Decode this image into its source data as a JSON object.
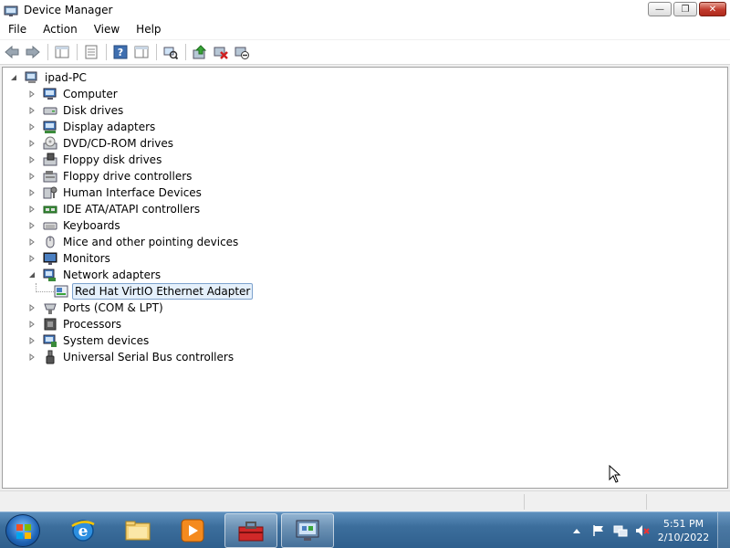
{
  "window": {
    "title": "Device Manager",
    "minimize_glyph": "—",
    "maximize_glyph": "❐",
    "close_glyph": "✕"
  },
  "menu": [
    "File",
    "Action",
    "View",
    "Help"
  ],
  "toolbar": {
    "buttons": [
      "back-icon",
      "forward-icon",
      "show-hide-console-tree-icon",
      "properties-icon",
      "help-icon",
      "action-pane-icon",
      "scan-hardware-icon",
      "update-driver-icon",
      "uninstall-icon",
      "disable-device-icon"
    ]
  },
  "tree": {
    "root": "ipad-PC",
    "categories": [
      {
        "label": "Computer",
        "icon": "computer-icon"
      },
      {
        "label": "Disk drives",
        "icon": "disk-drive-icon"
      },
      {
        "label": "Display adapters",
        "icon": "display-adapter-icon"
      },
      {
        "label": "DVD/CD-ROM drives",
        "icon": "dvd-drive-icon"
      },
      {
        "label": "Floppy disk drives",
        "icon": "floppy-disk-icon"
      },
      {
        "label": "Floppy drive controllers",
        "icon": "floppy-controller-icon"
      },
      {
        "label": "Human Interface Devices",
        "icon": "hid-icon"
      },
      {
        "label": "IDE ATA/ATAPI controllers",
        "icon": "ide-controller-icon"
      },
      {
        "label": "Keyboards",
        "icon": "keyboard-icon"
      },
      {
        "label": "Mice and other pointing devices",
        "icon": "mouse-icon"
      },
      {
        "label": "Monitors",
        "icon": "monitor-icon"
      },
      {
        "label": "Network adapters",
        "icon": "network-adapter-icon",
        "expanded": true
      },
      {
        "label": "Ports (COM & LPT)",
        "icon": "port-icon"
      },
      {
        "label": "Processors",
        "icon": "processor-icon"
      },
      {
        "label": "System devices",
        "icon": "system-device-icon"
      },
      {
        "label": "Universal Serial Bus controllers",
        "icon": "usb-icon"
      }
    ],
    "network_child": "Red Hat VirtIO Ethernet Adapter"
  },
  "taskbar": {
    "pinned": [
      "internet-explorer-icon",
      "windows-explorer-icon",
      "media-player-icon",
      "toolbox-icon",
      "device-manager-taskbar-icon"
    ],
    "clock_time": "5:51 PM",
    "clock_date": "2/10/2022"
  },
  "colors": {
    "selection_border": "#7da2ce",
    "selection_fill": "#e5f0fb",
    "taskbar": "#3c6e9c"
  }
}
